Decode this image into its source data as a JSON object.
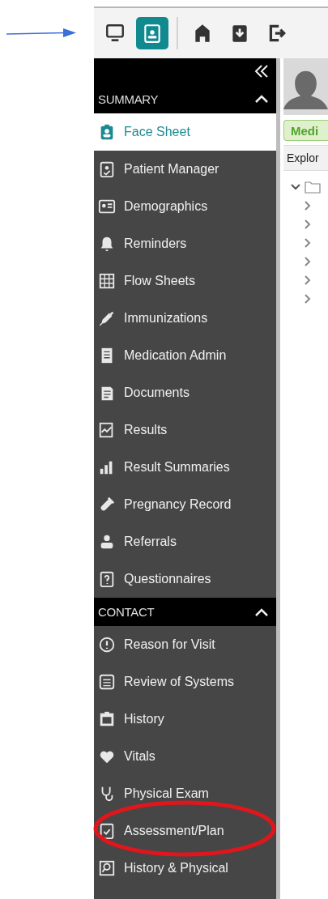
{
  "toolbar": [
    {
      "selected": false
    },
    {
      "selected": true
    },
    {
      "selected": false
    },
    {
      "selected": false
    },
    {
      "selected": false
    }
  ],
  "sidebar": {
    "sections": [
      {
        "title": "SUMMARY",
        "expanded": true,
        "items": [
          {
            "label": "Face Sheet",
            "selected": true
          },
          {
            "label": "Patient Manager",
            "selected": false
          },
          {
            "label": "Demographics",
            "selected": false
          },
          {
            "label": "Reminders",
            "selected": false
          },
          {
            "label": "Flow Sheets",
            "selected": false
          },
          {
            "label": "Immunizations",
            "selected": false
          },
          {
            "label": "Medication Admin",
            "selected": false
          },
          {
            "label": "Documents",
            "selected": false
          },
          {
            "label": "Results",
            "selected": false
          },
          {
            "label": "Result Summaries",
            "selected": false
          },
          {
            "label": "Pregnancy Record",
            "selected": false
          },
          {
            "label": "Referrals",
            "selected": false
          },
          {
            "label": "Questionnaires",
            "selected": false
          }
        ]
      },
      {
        "title": "CONTACT",
        "expanded": true,
        "items": [
          {
            "label": "Reason for Visit",
            "selected": false
          },
          {
            "label": "Review of Systems",
            "selected": false
          },
          {
            "label": "History",
            "selected": false
          },
          {
            "label": "Vitals",
            "selected": false
          },
          {
            "label": "Physical Exam",
            "selected": false
          },
          {
            "label": "Assessment/Plan",
            "selected": false
          },
          {
            "label": "History & Physical",
            "selected": false
          }
        ]
      }
    ]
  },
  "panel": {
    "tab": {
      "label": "Medi",
      "selected": true
    },
    "explorer_label": "Explor",
    "tree": {
      "expanded": true,
      "children": [
        {
          "expanded": false
        },
        {
          "expanded": false
        },
        {
          "expanded": false
        },
        {
          "expanded": false
        },
        {
          "expanded": false
        },
        {
          "expanded": false
        }
      ]
    }
  }
}
